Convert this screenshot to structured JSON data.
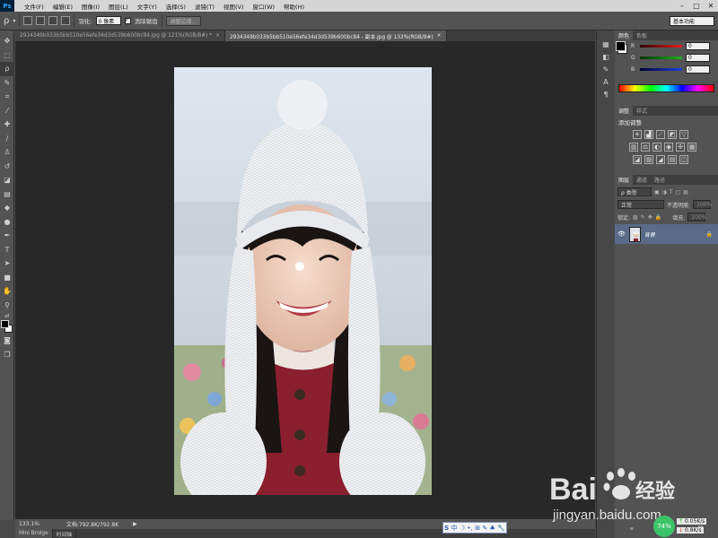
{
  "app": {
    "logo": "Ps"
  },
  "menubar": {
    "items": [
      "文件(F)",
      "编辑(E)",
      "图像(I)",
      "图层(L)",
      "文字(Y)",
      "选择(S)",
      "滤镜(T)",
      "视图(V)",
      "窗口(W)",
      "帮助(H)"
    ]
  },
  "options": {
    "feather_label": "羽化:",
    "feather_value": "0 像素",
    "antialias_label": "消除锯齿",
    "refine_button": "调整边缘...",
    "workspace": "基本功能"
  },
  "tabs": [
    {
      "label": "2934349b033b5bb510e56efe34d3d539b600bc84.jpg @ 121%(RGB/8#) *",
      "active": false,
      "close": "×"
    },
    {
      "label": "2934349b033b5bb510e56efe34d3d539b600bc84 - 副本.jpg @ 133%(RGB/8#)",
      "active": true,
      "close": "×"
    }
  ],
  "status": {
    "zoom": "133.1%",
    "doc_info": "文档:792.8K/792.8K",
    "arrow": "▶"
  },
  "bottom_tabs": [
    "Mini Bridge",
    "时间轴"
  ],
  "color_panel": {
    "tabs": [
      "颜色",
      "色板"
    ],
    "channels": [
      {
        "label": "R",
        "value": "0",
        "color": "#e22020"
      },
      {
        "label": "G",
        "value": "0",
        "color": "#20b020"
      },
      {
        "label": "B",
        "value": "0",
        "color": "#2040e0"
      }
    ]
  },
  "adjust_panel": {
    "tabs": [
      "调整",
      "样式"
    ],
    "title": "添加调整"
  },
  "layers_panel": {
    "tabs": [
      "图层",
      "通道",
      "路径"
    ],
    "kind_label": "ρ 类型",
    "blend_mode": "正常",
    "opacity_label": "不透明度:",
    "opacity_value": "100%",
    "lock_label": "锁定:",
    "fill_label": "填充:",
    "fill_value": "100%",
    "layers": [
      {
        "name": "背景",
        "visible": true,
        "locked": true
      }
    ]
  },
  "watermark": {
    "brand": "Bai",
    "brand_cn": "经验",
    "url": "jingyan.baidu.com"
  },
  "netmon": {
    "percent": "74%",
    "up": "0.05K/s",
    "down": "0.8K/s"
  },
  "ime": {
    "chars": [
      "中",
      "☽",
      "•,",
      "⊞",
      "✎",
      "♣",
      "🔧"
    ]
  }
}
